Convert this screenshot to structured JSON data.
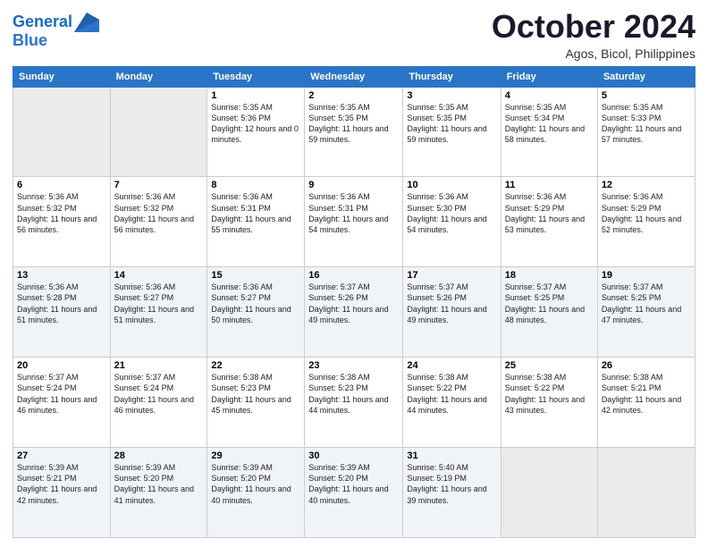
{
  "logo": {
    "line1": "General",
    "line2": "Blue"
  },
  "title": "October 2024",
  "subtitle": "Agos, Bicol, Philippines",
  "days": [
    "Sunday",
    "Monday",
    "Tuesday",
    "Wednesday",
    "Thursday",
    "Friday",
    "Saturday"
  ],
  "weeks": [
    [
      {
        "date": "",
        "sunrise": "",
        "sunset": "",
        "daylight": ""
      },
      {
        "date": "",
        "sunrise": "",
        "sunset": "",
        "daylight": ""
      },
      {
        "date": "1",
        "sunrise": "Sunrise: 5:35 AM",
        "sunset": "Sunset: 5:36 PM",
        "daylight": "Daylight: 12 hours and 0 minutes."
      },
      {
        "date": "2",
        "sunrise": "Sunrise: 5:35 AM",
        "sunset": "Sunset: 5:35 PM",
        "daylight": "Daylight: 11 hours and 59 minutes."
      },
      {
        "date": "3",
        "sunrise": "Sunrise: 5:35 AM",
        "sunset": "Sunset: 5:35 PM",
        "daylight": "Daylight: 11 hours and 59 minutes."
      },
      {
        "date": "4",
        "sunrise": "Sunrise: 5:35 AM",
        "sunset": "Sunset: 5:34 PM",
        "daylight": "Daylight: 11 hours and 58 minutes."
      },
      {
        "date": "5",
        "sunrise": "Sunrise: 5:35 AM",
        "sunset": "Sunset: 5:33 PM",
        "daylight": "Daylight: 11 hours and 57 minutes."
      }
    ],
    [
      {
        "date": "6",
        "sunrise": "Sunrise: 5:36 AM",
        "sunset": "Sunset: 5:32 PM",
        "daylight": "Daylight: 11 hours and 56 minutes."
      },
      {
        "date": "7",
        "sunrise": "Sunrise: 5:36 AM",
        "sunset": "Sunset: 5:32 PM",
        "daylight": "Daylight: 11 hours and 56 minutes."
      },
      {
        "date": "8",
        "sunrise": "Sunrise: 5:36 AM",
        "sunset": "Sunset: 5:31 PM",
        "daylight": "Daylight: 11 hours and 55 minutes."
      },
      {
        "date": "9",
        "sunrise": "Sunrise: 5:36 AM",
        "sunset": "Sunset: 5:31 PM",
        "daylight": "Daylight: 11 hours and 54 minutes."
      },
      {
        "date": "10",
        "sunrise": "Sunrise: 5:36 AM",
        "sunset": "Sunset: 5:30 PM",
        "daylight": "Daylight: 11 hours and 54 minutes."
      },
      {
        "date": "11",
        "sunrise": "Sunrise: 5:36 AM",
        "sunset": "Sunset: 5:29 PM",
        "daylight": "Daylight: 11 hours and 53 minutes."
      },
      {
        "date": "12",
        "sunrise": "Sunrise: 5:36 AM",
        "sunset": "Sunset: 5:29 PM",
        "daylight": "Daylight: 11 hours and 52 minutes."
      }
    ],
    [
      {
        "date": "13",
        "sunrise": "Sunrise: 5:36 AM",
        "sunset": "Sunset: 5:28 PM",
        "daylight": "Daylight: 11 hours and 51 minutes."
      },
      {
        "date": "14",
        "sunrise": "Sunrise: 5:36 AM",
        "sunset": "Sunset: 5:27 PM",
        "daylight": "Daylight: 11 hours and 51 minutes."
      },
      {
        "date": "15",
        "sunrise": "Sunrise: 5:36 AM",
        "sunset": "Sunset: 5:27 PM",
        "daylight": "Daylight: 11 hours and 50 minutes."
      },
      {
        "date": "16",
        "sunrise": "Sunrise: 5:37 AM",
        "sunset": "Sunset: 5:26 PM",
        "daylight": "Daylight: 11 hours and 49 minutes."
      },
      {
        "date": "17",
        "sunrise": "Sunrise: 5:37 AM",
        "sunset": "Sunset: 5:26 PM",
        "daylight": "Daylight: 11 hours and 49 minutes."
      },
      {
        "date": "18",
        "sunrise": "Sunrise: 5:37 AM",
        "sunset": "Sunset: 5:25 PM",
        "daylight": "Daylight: 11 hours and 48 minutes."
      },
      {
        "date": "19",
        "sunrise": "Sunrise: 5:37 AM",
        "sunset": "Sunset: 5:25 PM",
        "daylight": "Daylight: 11 hours and 47 minutes."
      }
    ],
    [
      {
        "date": "20",
        "sunrise": "Sunrise: 5:37 AM",
        "sunset": "Sunset: 5:24 PM",
        "daylight": "Daylight: 11 hours and 46 minutes."
      },
      {
        "date": "21",
        "sunrise": "Sunrise: 5:37 AM",
        "sunset": "Sunset: 5:24 PM",
        "daylight": "Daylight: 11 hours and 46 minutes."
      },
      {
        "date": "22",
        "sunrise": "Sunrise: 5:38 AM",
        "sunset": "Sunset: 5:23 PM",
        "daylight": "Daylight: 11 hours and 45 minutes."
      },
      {
        "date": "23",
        "sunrise": "Sunrise: 5:38 AM",
        "sunset": "Sunset: 5:23 PM",
        "daylight": "Daylight: 11 hours and 44 minutes."
      },
      {
        "date": "24",
        "sunrise": "Sunrise: 5:38 AM",
        "sunset": "Sunset: 5:22 PM",
        "daylight": "Daylight: 11 hours and 44 minutes."
      },
      {
        "date": "25",
        "sunrise": "Sunrise: 5:38 AM",
        "sunset": "Sunset: 5:22 PM",
        "daylight": "Daylight: 11 hours and 43 minutes."
      },
      {
        "date": "26",
        "sunrise": "Sunrise: 5:38 AM",
        "sunset": "Sunset: 5:21 PM",
        "daylight": "Daylight: 11 hours and 42 minutes."
      }
    ],
    [
      {
        "date": "27",
        "sunrise": "Sunrise: 5:39 AM",
        "sunset": "Sunset: 5:21 PM",
        "daylight": "Daylight: 11 hours and 42 minutes."
      },
      {
        "date": "28",
        "sunrise": "Sunrise: 5:39 AM",
        "sunset": "Sunset: 5:20 PM",
        "daylight": "Daylight: 11 hours and 41 minutes."
      },
      {
        "date": "29",
        "sunrise": "Sunrise: 5:39 AM",
        "sunset": "Sunset: 5:20 PM",
        "daylight": "Daylight: 11 hours and 40 minutes."
      },
      {
        "date": "30",
        "sunrise": "Sunrise: 5:39 AM",
        "sunset": "Sunset: 5:20 PM",
        "daylight": "Daylight: 11 hours and 40 minutes."
      },
      {
        "date": "31",
        "sunrise": "Sunrise: 5:40 AM",
        "sunset": "Sunset: 5:19 PM",
        "daylight": "Daylight: 11 hours and 39 minutes."
      },
      {
        "date": "",
        "sunrise": "",
        "sunset": "",
        "daylight": ""
      },
      {
        "date": "",
        "sunrise": "",
        "sunset": "",
        "daylight": ""
      }
    ]
  ]
}
